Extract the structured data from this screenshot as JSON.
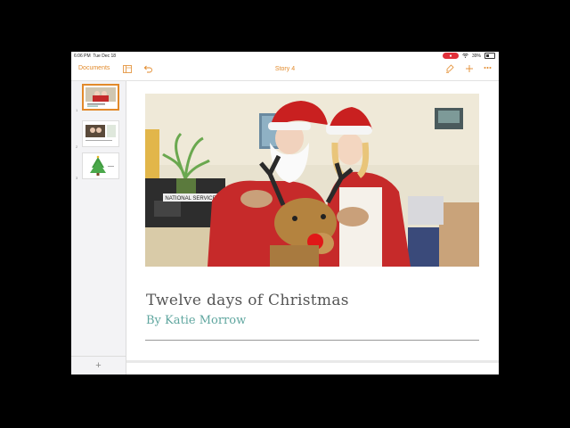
{
  "status": {
    "time": "6:06 PM",
    "date": "Tue Dec 18",
    "recording_color": "#e0303a",
    "battery": "39%"
  },
  "toolbar": {
    "documents_label": "Documents",
    "title": "Story 4",
    "accent_color": "#e28a2b",
    "icons": [
      "sidebar-layout-icon",
      "undo-icon",
      "format-brush-icon",
      "add-icon",
      "more-icon"
    ]
  },
  "sidebar": {
    "pages": [
      {
        "number": "1",
        "selected": true
      },
      {
        "number": "2",
        "selected": false
      },
      {
        "number": "3",
        "selected": false
      }
    ],
    "add_label": "+"
  },
  "document": {
    "title": "Twelve days of Christmas",
    "subtitle": "By Katie Morrow",
    "photo_sign_text": "NATIONAL SERVICE",
    "subtitle_color": "#5fa69f"
  }
}
